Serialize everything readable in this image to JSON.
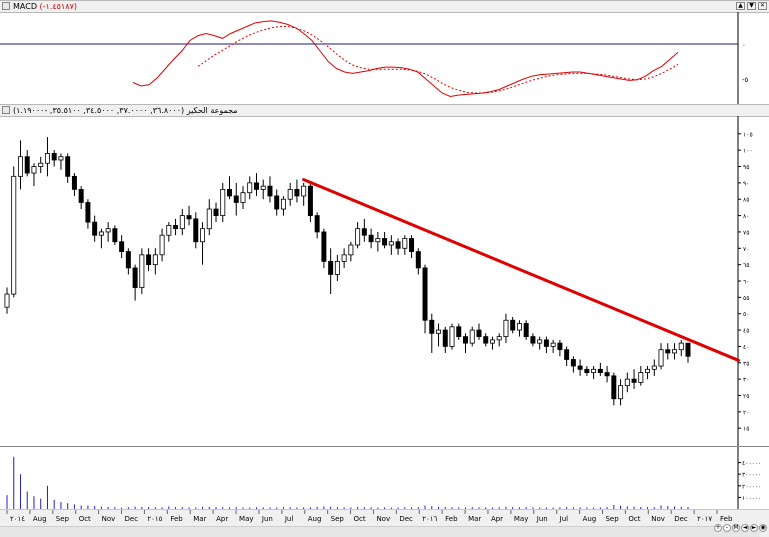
{
  "macd_panel": {
    "title_prefix": "MACD",
    "title_values": "(-١.٤٥١٨٧)",
    "axis_labels": [
      "٠",
      "-٥"
    ]
  },
  "price_panel": {
    "title_prefix": "مجموعة الحكير",
    "title_values": "(٣٦.٨٠٠٠, ٣٧.٠٠٠٠, ٣٤.٥٠٠٠, ٣٥.٥١٠٠, -١.١٩٠٠٠)",
    "axis_labels": [
      "١٠٥",
      "١٠٠",
      "٩٥",
      "٩٠",
      "٨٥",
      "٨٠",
      "٧٥",
      "٧٠",
      "٦٥",
      "٦٠",
      "٥٥",
      "٥٠",
      "٤٥",
      "٤٠",
      "٣٥",
      "٣٠",
      "٢٥",
      "٢٠",
      "١٥"
    ]
  },
  "volume_panel": {
    "axis_labels": [
      "٤٠٠٠٠٠",
      "٣٠٠٠٠٠",
      "٢٠٠٠٠٠",
      "١٠٠٠٠٠"
    ]
  },
  "time_axis": {
    "labels": [
      "٢٠١٤",
      "Aug",
      "Sep",
      "Oct",
      "Nov",
      "Dec",
      "٢٠١٥",
      "Feb",
      "Mar",
      "Apr",
      "May",
      "Jun",
      "Jul",
      "Aug",
      "Sep",
      "Oct",
      "Nov",
      "Dec",
      "٢٠١٦",
      "Feb",
      "Mar",
      "Apr",
      "May",
      "Jun",
      "Jul",
      "Aug",
      "Sep",
      "Oct",
      "Nov",
      "Dec",
      "٢٠١٧",
      "Feb"
    ]
  },
  "window_controls": [
    "▲",
    "▼",
    "✕"
  ],
  "nav_controls": [
    "+",
    "-",
    "M",
    "◄",
    "►",
    "◉"
  ],
  "colors": {
    "trendline": "#e00000",
    "macd_line": "#e00000",
    "signal_line": "#e00000",
    "zero_line": "#1a1a80",
    "volume_bar": "#2020c0",
    "candle_up": "#ffffff",
    "candle_down": "#000000"
  },
  "chart_data": {
    "type": "candlestick",
    "price_ylim": [
      12,
      108
    ],
    "macd_ylim": [
      -8,
      4
    ],
    "volume_ylim": [
      0,
      500000
    ],
    "trendline": {
      "from": {
        "index": 44,
        "price": 91
      },
      "to": {
        "index": 107,
        "price": 37
      }
    },
    "candles": [
      [
        52,
        58,
        50,
        56
      ],
      [
        56,
        95,
        55,
        92
      ],
      [
        92,
        103,
        88,
        98
      ],
      [
        98,
        100,
        92,
        93
      ],
      [
        93,
        96,
        89,
        95
      ],
      [
        95,
        98,
        93,
        96
      ],
      [
        96,
        104,
        92,
        99
      ],
      [
        99,
        100,
        95,
        97
      ],
      [
        97,
        99,
        94,
        98
      ],
      [
        98,
        99,
        90,
        92
      ],
      [
        92,
        93,
        86,
        88
      ],
      [
        88,
        89,
        82,
        84
      ],
      [
        84,
        85,
        76,
        78
      ],
      [
        78,
        80,
        72,
        74
      ],
      [
        74,
        76,
        70,
        75
      ],
      [
        75,
        78,
        72,
        76
      ],
      [
        76,
        77,
        71,
        72
      ],
      [
        72,
        74,
        67,
        69
      ],
      [
        69,
        70,
        62,
        64
      ],
      [
        64,
        65,
        54,
        58
      ],
      [
        58,
        70,
        56,
        68
      ],
      [
        68,
        70,
        63,
        65
      ],
      [
        65,
        70,
        62,
        68
      ],
      [
        68,
        76,
        66,
        74
      ],
      [
        74,
        78,
        72,
        77
      ],
      [
        77,
        79,
        74,
        76
      ],
      [
        76,
        82,
        74,
        80
      ],
      [
        80,
        83,
        77,
        79
      ],
      [
        79,
        81,
        70,
        72
      ],
      [
        72,
        78,
        65,
        76
      ],
      [
        76,
        85,
        74,
        82
      ],
      [
        82,
        84,
        78,
        80
      ],
      [
        80,
        90,
        78,
        88
      ],
      [
        88,
        92,
        85,
        86
      ],
      [
        86,
        90,
        80,
        84
      ],
      [
        84,
        89,
        82,
        87
      ],
      [
        87,
        92,
        85,
        90
      ],
      [
        90,
        93,
        86,
        88
      ],
      [
        88,
        91,
        85,
        89
      ],
      [
        89,
        92,
        84,
        86
      ],
      [
        86,
        88,
        80,
        82
      ],
      [
        82,
        86,
        80,
        85
      ],
      [
        85,
        90,
        83,
        88
      ],
      [
        88,
        91,
        84,
        86
      ],
      [
        86,
        90,
        83,
        89
      ],
      [
        89,
        90,
        78,
        80
      ],
      [
        80,
        81,
        73,
        75
      ],
      [
        75,
        76,
        64,
        66
      ],
      [
        66,
        70,
        56,
        62
      ],
      [
        62,
        68,
        60,
        66
      ],
      [
        66,
        70,
        64,
        68
      ],
      [
        68,
        72,
        66,
        71
      ],
      [
        71,
        78,
        70,
        76
      ],
      [
        76,
        79,
        72,
        74
      ],
      [
        74,
        76,
        70,
        72
      ],
      [
        72,
        75,
        69,
        73
      ],
      [
        73,
        75,
        70,
        71
      ],
      [
        71,
        74,
        68,
        72
      ],
      [
        72,
        73,
        68,
        70
      ],
      [
        70,
        74,
        68,
        73
      ],
      [
        73,
        74,
        67,
        69
      ],
      [
        69,
        70,
        62,
        64
      ],
      [
        64,
        65,
        44,
        48
      ],
      [
        48,
        50,
        38,
        44
      ],
      [
        44,
        47,
        40,
        45
      ],
      [
        45,
        46,
        38,
        40
      ],
      [
        40,
        47,
        39,
        46
      ],
      [
        46,
        47,
        42,
        43
      ],
      [
        43,
        44,
        38,
        41
      ],
      [
        41,
        46,
        40,
        45
      ],
      [
        45,
        47,
        42,
        43
      ],
      [
        43,
        44,
        40,
        41
      ],
      [
        41,
        43,
        39,
        42
      ],
      [
        42,
        44,
        40,
        43
      ],
      [
        43,
        50,
        41,
        48
      ],
      [
        48,
        49,
        44,
        45
      ],
      [
        45,
        48,
        43,
        47
      ],
      [
        47,
        48,
        42,
        43
      ],
      [
        43,
        44,
        40,
        41
      ],
      [
        41,
        43,
        39,
        42
      ],
      [
        42,
        43,
        38,
        40
      ],
      [
        40,
        42,
        38,
        41
      ],
      [
        41,
        42,
        37,
        39
      ],
      [
        39,
        40,
        34,
        36
      ],
      [
        36,
        37,
        32,
        34
      ],
      [
        34,
        36,
        31,
        33
      ],
      [
        33,
        34,
        31,
        32
      ],
      [
        32,
        34,
        30,
        33
      ],
      [
        33,
        35,
        31,
        32
      ],
      [
        32,
        34,
        29,
        31
      ],
      [
        31,
        32,
        22,
        24
      ],
      [
        24,
        30,
        22,
        28
      ],
      [
        28,
        32,
        26,
        30
      ],
      [
        30,
        33,
        27,
        29
      ],
      [
        29,
        34,
        28,
        32
      ],
      [
        32,
        34,
        30,
        33
      ],
      [
        33,
        36,
        31,
        34
      ],
      [
        34,
        41,
        33,
        39
      ],
      [
        39,
        41,
        36,
        38
      ],
      [
        38,
        41,
        36,
        39
      ],
      [
        39,
        42,
        37,
        41
      ],
      [
        41,
        41,
        35,
        37
      ]
    ],
    "volume": [
      120000,
      450000,
      300000,
      150000,
      110000,
      90000,
      200000,
      80000,
      60000,
      50000,
      40000,
      30000,
      30000,
      25000,
      20000,
      18000,
      15000,
      12000,
      15000,
      20000,
      18000,
      16000,
      15000,
      14000,
      22000,
      16000,
      15000,
      14000,
      13000,
      20000,
      18000,
      16000,
      15000,
      14000,
      15000,
      13000,
      12000,
      15000,
      14000,
      13000,
      12000,
      16000,
      14000,
      13000,
      15000,
      14000,
      18000,
      22000,
      20000,
      16000,
      15000,
      14000,
      18000,
      16000,
      15000,
      13000,
      14000,
      12000,
      13000,
      15000,
      14000,
      16000,
      30000,
      25000,
      20000,
      18000,
      15000,
      14000,
      13000,
      16000,
      14000,
      13000,
      12000,
      14000,
      20000,
      16000,
      14000,
      15000,
      14000,
      12000,
      13000,
      12000,
      14000,
      16000,
      15000,
      14000,
      13000,
      12000,
      14000,
      16000,
      35000,
      28000,
      22000,
      20000,
      18000,
      16000,
      15000,
      30000,
      25000,
      22000,
      20000,
      16000
    ],
    "macd": [
      -5.5,
      -6,
      -5.8,
      -4.8,
      -3.5,
      -2.2,
      -1,
      0.5,
      1.2,
      1.5,
      1.2,
      0.8,
      1.5,
      2,
      2.5,
      3,
      3.2,
      3.3,
      3.1,
      2.8,
      2.3,
      1.5,
      0.5,
      -1,
      -2.5,
      -3.5,
      -4,
      -4.2,
      -4,
      -3.8,
      -3.5,
      -3.3,
      -3.3,
      -3.4,
      -3.6,
      -4,
      -5,
      -6,
      -7,
      -7.5,
      -7.3,
      -7.2,
      -7.1,
      -7,
      -6.8,
      -6.5,
      -6,
      -5.5,
      -5,
      -4.6,
      -4.4,
      -4.3,
      -4.2,
      -4.1,
      -4,
      -4,
      -4.2,
      -4.4,
      -4.6,
      -4.8,
      -5,
      -5.2,
      -5.1,
      -4.6,
      -3.8,
      -3.2,
      -2.2,
      -1.2
    ],
    "signal": [
      null,
      null,
      null,
      null,
      null,
      null,
      null,
      null,
      -3.2,
      -2.4,
      -1.6,
      -0.9,
      -0.2,
      0.5,
      1.1,
      1.6,
      2,
      2.3,
      2.5,
      2.5,
      2.3,
      1.9,
      1.3,
      0.5,
      -0.4,
      -1.4,
      -2.3,
      -3,
      -3.4,
      -3.6,
      -3.6,
      -3.6,
      -3.6,
      -3.6,
      -3.7,
      -3.9,
      -4.3,
      -4.9,
      -5.6,
      -6.2,
      -6.6,
      -6.9,
      -7,
      -7,
      -6.9,
      -6.7,
      -6.4,
      -6,
      -5.6,
      -5.2,
      -4.9,
      -4.6,
      -4.4,
      -4.3,
      -4.2,
      -4.2,
      -4.2,
      -4.3,
      -4.4,
      -4.6,
      -4.8,
      -5,
      -5.1,
      -5,
      -4.7,
      -4.2,
      -3.6,
      -2.9
    ]
  }
}
